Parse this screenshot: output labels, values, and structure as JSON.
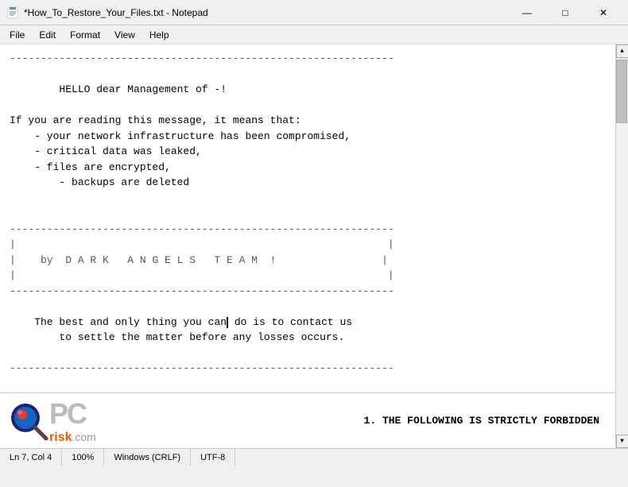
{
  "titlebar": {
    "title": "*How_To_Restore_Your_Files.txt - Notepad",
    "icon": "notepad",
    "minimize_label": "—",
    "maximize_label": "□",
    "close_label": "✕"
  },
  "menubar": {
    "items": [
      "File",
      "Edit",
      "Format",
      "View",
      "Help"
    ]
  },
  "editor": {
    "content_lines": [
      "--------------------------------------------------------------",
      "",
      "        HELLO dear Management of -!",
      "",
      "If you are reading this message, it means that:",
      "    - your network infrastructure has been compromised,",
      "    - critical data was leaked,",
      "    - files are encrypted,",
      "        - backups are deleted",
      "",
      "",
      "--------------------------------------------------------------",
      "|                                                            |",
      "|    by  D A R K   A N G E L S   T E A M  !                 |",
      "|                                                            |",
      "--------------------------------------------------------------",
      "",
      "    The best and only thing you can do is to contact us",
      "        to settle the matter before any losses occurs.",
      "",
      "--------------------------------------------------------------",
      "",
      "    1. THE FOLLOWING IS STRICTLY FORBIDDEN"
    ]
  },
  "statusbar": {
    "position": "Ln 7, Col 4",
    "zoom": "100%",
    "line_ending": "Windows (CRLF)",
    "encoding": "UTF-8"
  },
  "watermark": {
    "pc_text": "PC",
    "risk_text": "risk",
    "com_text": ".com",
    "warning_text": "1. THE FOLLOWING IS STRICTLY FORBIDDEN"
  }
}
